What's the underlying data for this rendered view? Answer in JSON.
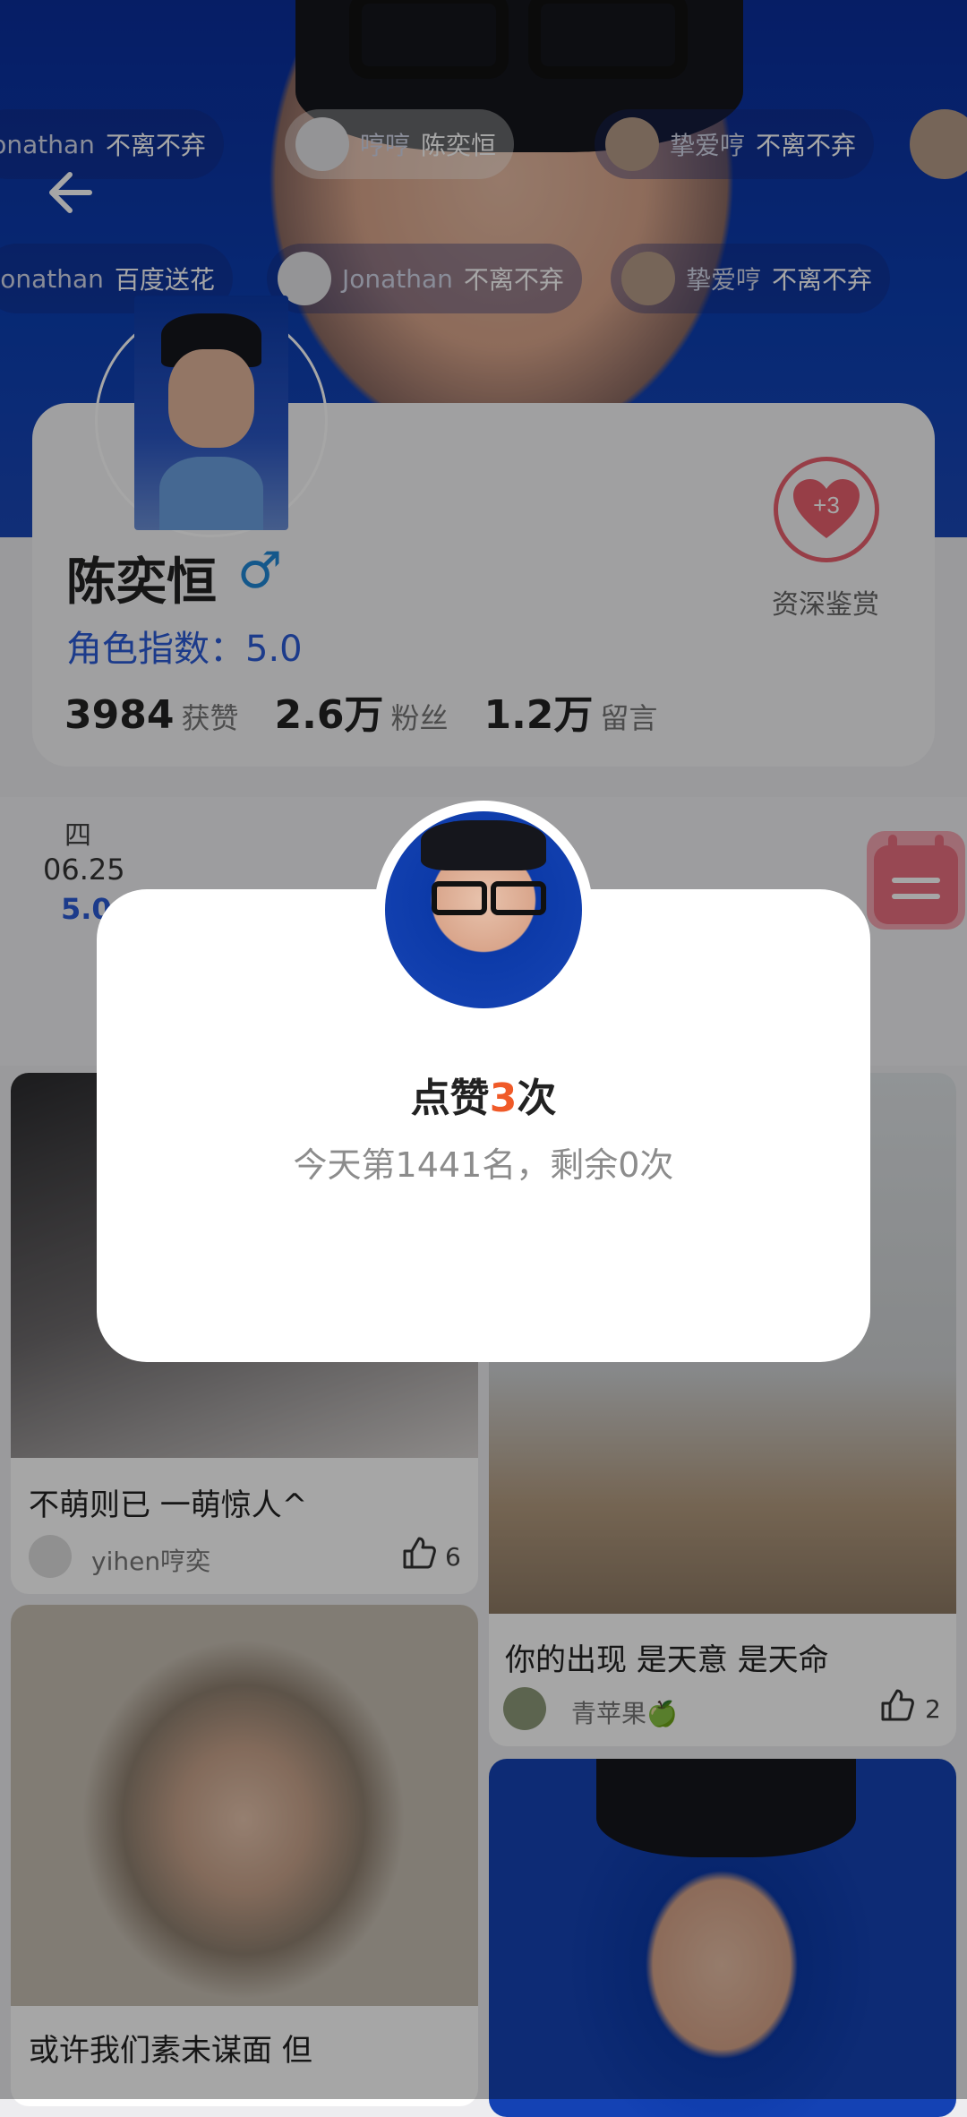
{
  "barrage": {
    "row1": [
      {
        "name": "Jonathan",
        "msg": "不离不弃"
      },
      {
        "name": "哼哼",
        "msg": "陈奕恒"
      },
      {
        "name": "挚爱哼",
        "msg": "不离不弃"
      }
    ],
    "row2": [
      {
        "name": "Jonathan",
        "msg": "百度送花"
      },
      {
        "name": "Jonathan",
        "msg": "不离不弃"
      },
      {
        "name": "挚爱哼",
        "msg": "不离不弃"
      }
    ]
  },
  "profile": {
    "name": "陈奕恒",
    "gender_symbol": "♂",
    "role_index": "角色指数：5.0",
    "stats": [
      {
        "num": "3984",
        "label": "获赞"
      },
      {
        "num": "2.6万",
        "label": "粉丝"
      },
      {
        "num": "1.2万",
        "label": "留言"
      }
    ],
    "badge_value": "+3",
    "badge_label": "资深鉴赏"
  },
  "date_strip": {
    "weekday": "四",
    "date": "06.25",
    "score": "5.0"
  },
  "posts": [
    {
      "title": "不萌则已 一萌惊人^",
      "author": "yihen哼奕",
      "likes": "6"
    },
    {
      "title": "你的出现 是天意 是天命",
      "author": "青苹果🍏",
      "likes": "2"
    },
    {
      "title": "或许我们素未谋面 但",
      "author": "",
      "likes": ""
    }
  ],
  "dialog": {
    "title_prefix": "点赞",
    "title_count": "3",
    "title_suffix": "次",
    "subtitle": "今天第1441名，剩余0次"
  },
  "colors": {
    "accent": "#f05a28",
    "blue": "#2c5bd6",
    "heart": "#e9606e"
  }
}
